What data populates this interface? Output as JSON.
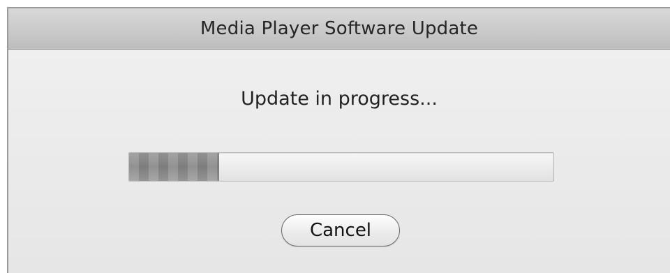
{
  "window": {
    "title": "Media Player Software Update"
  },
  "status": {
    "message": "Update in progress..."
  },
  "progress": {
    "value_percent": 21
  },
  "buttons": {
    "cancel_label": "Cancel"
  }
}
